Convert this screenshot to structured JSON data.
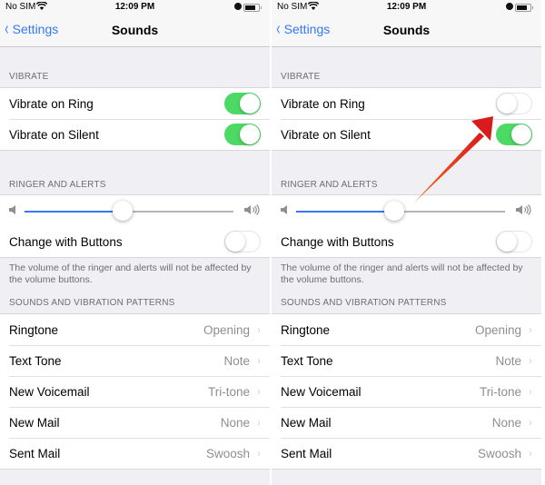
{
  "panels": [
    {
      "status_bar": {
        "carrier": "No SIM",
        "wifi_icon": "wifi-icon",
        "time": "12:09 PM",
        "alarm_icon": "alarm-icon",
        "battery_icon": "battery-icon"
      },
      "nav": {
        "back_label": "Settings",
        "title": "Sounds"
      },
      "vibrate": {
        "header": "VIBRATE",
        "items": [
          {
            "label": "Vibrate on Ring",
            "on": true
          },
          {
            "label": "Vibrate on Silent",
            "on": true
          }
        ]
      },
      "ringer": {
        "header": "RINGER AND ALERTS",
        "volume_fraction": 0.47,
        "change_with_buttons": {
          "label": "Change with Buttons",
          "on": false
        },
        "note": "The volume of the ringer and alerts will not be affected by the volume buttons."
      },
      "patterns": {
        "header": "SOUNDS AND VIBRATION PATTERNS",
        "items": [
          {
            "label": "Ringtone",
            "value": "Opening"
          },
          {
            "label": "Text Tone",
            "value": "Note"
          },
          {
            "label": "New Voicemail",
            "value": "Tri-tone"
          },
          {
            "label": "New Mail",
            "value": "None"
          },
          {
            "label": "Sent Mail",
            "value": "Swoosh"
          }
        ]
      }
    },
    {
      "status_bar": {
        "carrier": "No SIM",
        "wifi_icon": "wifi-icon",
        "time": "12:09 PM",
        "alarm_icon": "alarm-icon",
        "battery_icon": "battery-icon"
      },
      "nav": {
        "back_label": "Settings",
        "title": "Sounds"
      },
      "vibrate": {
        "header": "VIBRATE",
        "items": [
          {
            "label": "Vibrate on Ring",
            "on": false
          },
          {
            "label": "Vibrate on Silent",
            "on": true
          }
        ]
      },
      "ringer": {
        "header": "RINGER AND ALERTS",
        "volume_fraction": 0.47,
        "change_with_buttons": {
          "label": "Change with Buttons",
          "on": false
        },
        "note": "The volume of the ringer and alerts will not be affected by the volume buttons."
      },
      "patterns": {
        "header": "SOUNDS AND VIBRATION PATTERNS",
        "items": [
          {
            "label": "Ringtone",
            "value": "Opening"
          },
          {
            "label": "Text Tone",
            "value": "Note"
          },
          {
            "label": "New Voicemail",
            "value": "Tri-tone"
          },
          {
            "label": "New Mail",
            "value": "None"
          },
          {
            "label": "Sent Mail",
            "value": "Swoosh"
          }
        ]
      }
    }
  ],
  "colors": {
    "accent": "#3478f6",
    "toggle_on": "#4cd964",
    "annotation_arrow": "#e5281b"
  },
  "icons": {
    "back": "‹",
    "chevron": "›",
    "wifi": "≋",
    "volume_low": "◀",
    "volume_high": "◀))"
  }
}
